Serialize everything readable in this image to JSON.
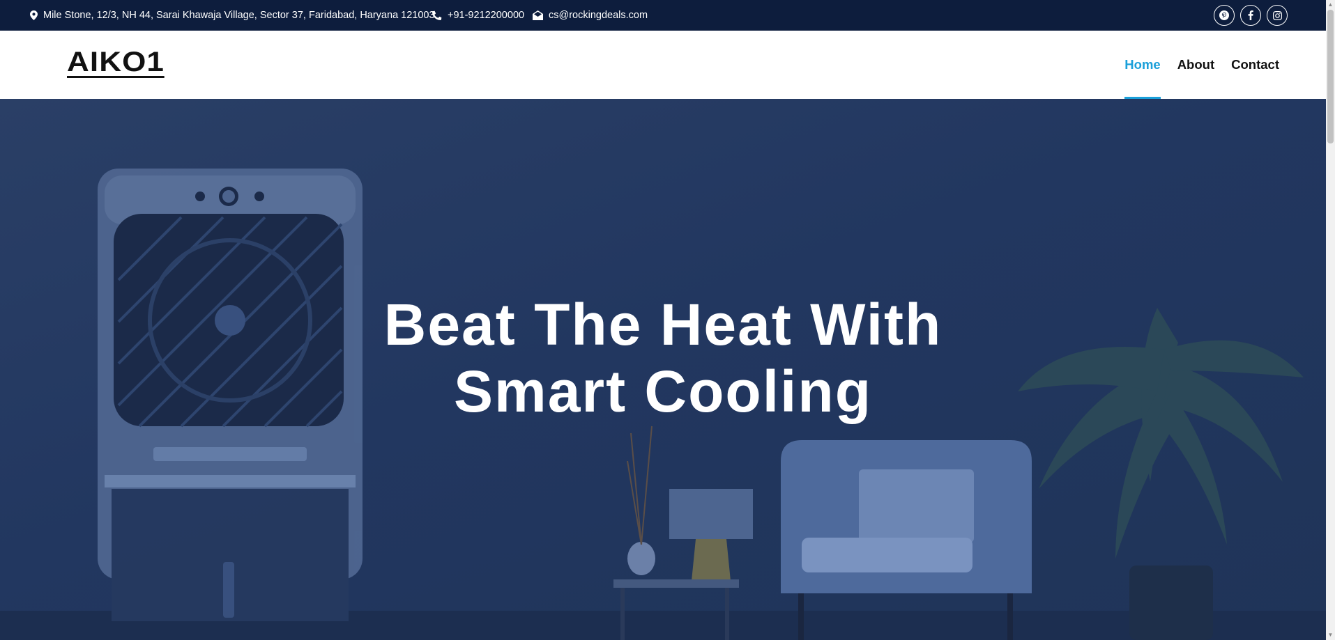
{
  "topbar": {
    "address": "Mile Stone, 12/3, NH 44, Sarai Khawaja Village, Sector 37, Faridabad, Haryana 121003",
    "phone": "+91-9212200000",
    "email": "cs@rockingdeals.com",
    "socials": [
      "pinterest-icon",
      "facebook-icon",
      "instagram-icon"
    ]
  },
  "header": {
    "logo": "AIKO1",
    "nav": [
      {
        "label": "Home",
        "active": true
      },
      {
        "label": "About",
        "active": false
      },
      {
        "label": "Contact",
        "active": false
      }
    ]
  },
  "hero": {
    "title_line1": "Beat The Heat With",
    "title_line2": "Smart Cooling"
  },
  "colors": {
    "topbar_bg": "#0d1d3d",
    "nav_active": "#1a9fd9",
    "hero_overlay": "#223760"
  }
}
